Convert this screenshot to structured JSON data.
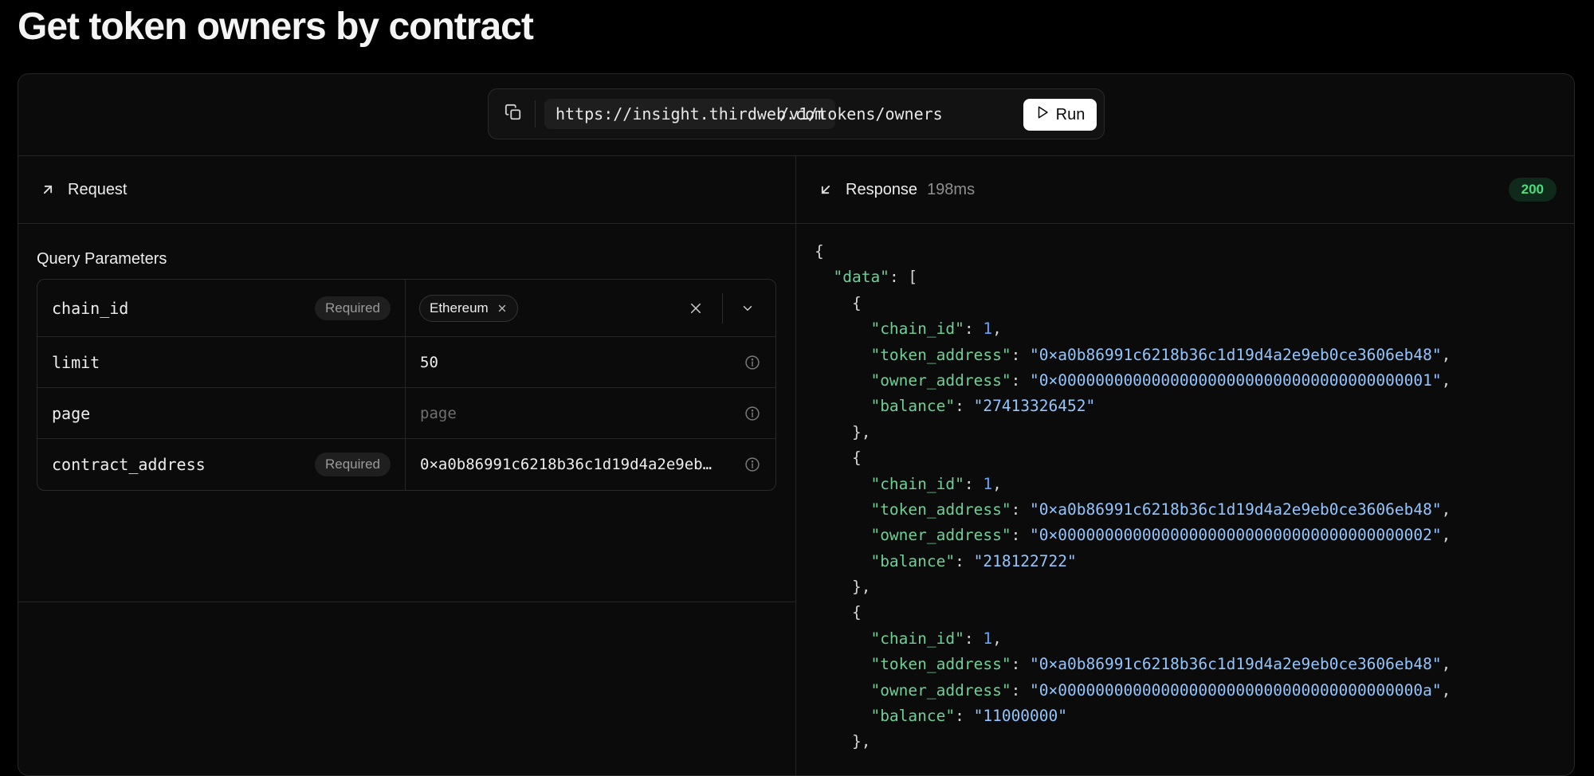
{
  "page": {
    "title": "Get token owners by contract"
  },
  "url_bar": {
    "base_url": "https://insight.thirdweb.com",
    "path": "/v1/tokens/owners",
    "run_label": "Run",
    "copy_icon": "copy-icon"
  },
  "request": {
    "header_label": "Request",
    "header_icon": "arrow-up-right-icon",
    "section_title": "Query Parameters",
    "params": [
      {
        "name": "chain_id",
        "required_label": "Required",
        "value": "Ethereum",
        "type": "chain-select"
      },
      {
        "name": "limit",
        "required_label": "",
        "value": "50",
        "placeholder": "",
        "type": "text"
      },
      {
        "name": "page",
        "required_label": "",
        "value": "",
        "placeholder": "page",
        "type": "text"
      },
      {
        "name": "contract_address",
        "required_label": "Required",
        "value": "0×a0b86991c6218b36c1d19d4a2e9eb…",
        "placeholder": "",
        "type": "text"
      }
    ]
  },
  "response": {
    "header_label": "Response",
    "header_icon": "arrow-down-left-icon",
    "time": "198ms",
    "status": "200",
    "status_color": "#4ade80",
    "json_lines": [
      [
        {
          "t": "{",
          "c": "p"
        }
      ],
      [
        {
          "t": "  ",
          "c": "p"
        },
        {
          "t": "\"data\"",
          "c": "k"
        },
        {
          "t": ": [",
          "c": "p"
        }
      ],
      [
        {
          "t": "    {",
          "c": "p"
        }
      ],
      [
        {
          "t": "      ",
          "c": "p"
        },
        {
          "t": "\"chain_id\"",
          "c": "k"
        },
        {
          "t": ": ",
          "c": "p"
        },
        {
          "t": "1",
          "c": "n"
        },
        {
          "t": ",",
          "c": "p"
        }
      ],
      [
        {
          "t": "      ",
          "c": "p"
        },
        {
          "t": "\"token_address\"",
          "c": "k"
        },
        {
          "t": ": ",
          "c": "p"
        },
        {
          "t": "\"0×a0b86991c6218b36c1d19d4a2e9eb0ce3606eb48\"",
          "c": "s"
        },
        {
          "t": ",",
          "c": "p"
        }
      ],
      [
        {
          "t": "      ",
          "c": "p"
        },
        {
          "t": "\"owner_address\"",
          "c": "k"
        },
        {
          "t": ": ",
          "c": "p"
        },
        {
          "t": "\"0×0000000000000000000000000000000000000001\"",
          "c": "s"
        },
        {
          "t": ",",
          "c": "p"
        }
      ],
      [
        {
          "t": "      ",
          "c": "p"
        },
        {
          "t": "\"balance\"",
          "c": "k"
        },
        {
          "t": ": ",
          "c": "p"
        },
        {
          "t": "\"27413326452\"",
          "c": "s"
        }
      ],
      [
        {
          "t": "    },",
          "c": "p"
        }
      ],
      [
        {
          "t": "    {",
          "c": "p"
        }
      ],
      [
        {
          "t": "      ",
          "c": "p"
        },
        {
          "t": "\"chain_id\"",
          "c": "k"
        },
        {
          "t": ": ",
          "c": "p"
        },
        {
          "t": "1",
          "c": "n"
        },
        {
          "t": ",",
          "c": "p"
        }
      ],
      [
        {
          "t": "      ",
          "c": "p"
        },
        {
          "t": "\"token_address\"",
          "c": "k"
        },
        {
          "t": ": ",
          "c": "p"
        },
        {
          "t": "\"0×a0b86991c6218b36c1d19d4a2e9eb0ce3606eb48\"",
          "c": "s"
        },
        {
          "t": ",",
          "c": "p"
        }
      ],
      [
        {
          "t": "      ",
          "c": "p"
        },
        {
          "t": "\"owner_address\"",
          "c": "k"
        },
        {
          "t": ": ",
          "c": "p"
        },
        {
          "t": "\"0×0000000000000000000000000000000000000002\"",
          "c": "s"
        },
        {
          "t": ",",
          "c": "p"
        }
      ],
      [
        {
          "t": "      ",
          "c": "p"
        },
        {
          "t": "\"balance\"",
          "c": "k"
        },
        {
          "t": ": ",
          "c": "p"
        },
        {
          "t": "\"218122722\"",
          "c": "s"
        }
      ],
      [
        {
          "t": "    },",
          "c": "p"
        }
      ],
      [
        {
          "t": "    {",
          "c": "p"
        }
      ],
      [
        {
          "t": "      ",
          "c": "p"
        },
        {
          "t": "\"chain_id\"",
          "c": "k"
        },
        {
          "t": ": ",
          "c": "p"
        },
        {
          "t": "1",
          "c": "n"
        },
        {
          "t": ",",
          "c": "p"
        }
      ],
      [
        {
          "t": "      ",
          "c": "p"
        },
        {
          "t": "\"token_address\"",
          "c": "k"
        },
        {
          "t": ": ",
          "c": "p"
        },
        {
          "t": "\"0×a0b86991c6218b36c1d19d4a2e9eb0ce3606eb48\"",
          "c": "s"
        },
        {
          "t": ",",
          "c": "p"
        }
      ],
      [
        {
          "t": "      ",
          "c": "p"
        },
        {
          "t": "\"owner_address\"",
          "c": "k"
        },
        {
          "t": ": ",
          "c": "p"
        },
        {
          "t": "\"0×000000000000000000000000000000000000000a\"",
          "c": "s"
        },
        {
          "t": ",",
          "c": "p"
        }
      ],
      [
        {
          "t": "      ",
          "c": "p"
        },
        {
          "t": "\"balance\"",
          "c": "k"
        },
        {
          "t": ": ",
          "c": "p"
        },
        {
          "t": "\"11000000\"",
          "c": "s"
        }
      ],
      [
        {
          "t": "    },",
          "c": "p"
        }
      ]
    ]
  },
  "colors": {
    "background": "#000000",
    "panel": "#0b0b0b",
    "border": "#262626",
    "json_key": "#6fcf97",
    "json_string": "#93c5fd",
    "json_number": "#60a5fa",
    "status_ok": "#4ade80"
  }
}
